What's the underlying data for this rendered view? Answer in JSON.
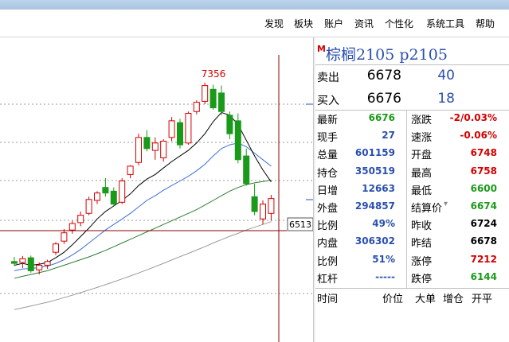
{
  "menu": [
    "发现",
    "板块",
    "账户",
    "资讯",
    "个性化",
    "系统工具",
    "帮助"
  ],
  "contract": {
    "marker": "M",
    "title": "棕榈2105  p2105"
  },
  "sell": {
    "label": "卖出",
    "price": "6678",
    "volume": "40"
  },
  "buy": {
    "label": "买入",
    "price": "6676",
    "volume": "18"
  },
  "left_stats": [
    {
      "label": "最新",
      "value": "6676",
      "color": "#1a9a1a"
    },
    {
      "label": "现手",
      "value": "27",
      "color": "#2a4fb0"
    },
    {
      "label": "总量",
      "value": "601159",
      "color": "#2a4fb0"
    },
    {
      "label": "持仓",
      "value": "350519",
      "color": "#2a4fb0"
    },
    {
      "label": "日增",
      "value": "12663",
      "color": "#2a4fb0"
    },
    {
      "label": "外盘",
      "value": "294857",
      "color": "#2a4fb0"
    },
    {
      "label": "比例",
      "value": "49%",
      "color": "#2a4fb0"
    },
    {
      "label": "内盘",
      "value": "306302",
      "color": "#2a4fb0"
    },
    {
      "label": "比例",
      "value": "51%",
      "color": "#2a4fb0"
    },
    {
      "label": "杠杆",
      "value": "-----",
      "color": "#2a4fb0"
    }
  ],
  "right_stats": [
    {
      "label": "涨跌",
      "value": "-2/0.03%",
      "color": "#d40000"
    },
    {
      "label": "速涨",
      "value": "-0.06%",
      "color": "#d40000"
    },
    {
      "label": "开盘",
      "value": "6748",
      "color": "#d40000"
    },
    {
      "label": "最高",
      "value": "6758",
      "color": "#d40000"
    },
    {
      "label": "最低",
      "value": "6600",
      "color": "#1a9a1a"
    },
    {
      "label": "结算价",
      "value": "6674",
      "color": "#1a9a1a"
    },
    {
      "label": "昨收",
      "value": "6724",
      "color": "#000000"
    },
    {
      "label": "昨结",
      "value": "6678",
      "color": "#000000"
    },
    {
      "label": "涨停",
      "value": "7212",
      "color": "#d40000"
    },
    {
      "label": "跌停",
      "value": "6144",
      "color": "#1a9a1a"
    }
  ],
  "footer": [
    "时间",
    "价位",
    "大单",
    "增仓",
    "开平"
  ],
  "chart_data": {
    "type": "candlestick",
    "high_label": "7356",
    "price_tag": "6513",
    "candles": [
      {
        "o": 6390,
        "h": 6415,
        "l": 6365,
        "c": 6380
      },
      {
        "o": 6385,
        "h": 6420,
        "l": 6355,
        "c": 6405
      },
      {
        "o": 6410,
        "h": 6422,
        "l": 6330,
        "c": 6340
      },
      {
        "o": 6345,
        "h": 6385,
        "l": 6320,
        "c": 6370
      },
      {
        "o": 6370,
        "h": 6400,
        "l": 6350,
        "c": 6390
      },
      {
        "o": 6440,
        "h": 6495,
        "l": 6425,
        "c": 6485
      },
      {
        "o": 6500,
        "h": 6565,
        "l": 6485,
        "c": 6545
      },
      {
        "o": 6560,
        "h": 6610,
        "l": 6540,
        "c": 6595
      },
      {
        "o": 6600,
        "h": 6660,
        "l": 6580,
        "c": 6640
      },
      {
        "o": 6650,
        "h": 6740,
        "l": 6640,
        "c": 6725
      },
      {
        "o": 6720,
        "h": 6770,
        "l": 6700,
        "c": 6760
      },
      {
        "o": 6790,
        "h": 6840,
        "l": 6740,
        "c": 6760
      },
      {
        "o": 6770,
        "h": 6790,
        "l": 6690,
        "c": 6700
      },
      {
        "o": 6710,
        "h": 6840,
        "l": 6700,
        "c": 6825
      },
      {
        "o": 6860,
        "h": 6910,
        "l": 6840,
        "c": 6905
      },
      {
        "o": 6925,
        "h": 7080,
        "l": 6910,
        "c": 7060
      },
      {
        "o": 7060,
        "h": 7100,
        "l": 6985,
        "c": 7000
      },
      {
        "o": 6990,
        "h": 7060,
        "l": 6940,
        "c": 7030
      },
      {
        "o": 6950,
        "h": 7050,
        "l": 6930,
        "c": 7040
      },
      {
        "o": 7060,
        "h": 7170,
        "l": 7040,
        "c": 7150
      },
      {
        "o": 7140,
        "h": 7160,
        "l": 7000,
        "c": 7020
      },
      {
        "o": 7030,
        "h": 7200,
        "l": 7020,
        "c": 7190
      },
      {
        "o": 7200,
        "h": 7260,
        "l": 7185,
        "c": 7250
      },
      {
        "o": 7255,
        "h": 7356,
        "l": 7240,
        "c": 7340
      },
      {
        "o": 7320,
        "h": 7345,
        "l": 7210,
        "c": 7220
      },
      {
        "o": 7300,
        "h": 7340,
        "l": 7180,
        "c": 7200
      },
      {
        "o": 7180,
        "h": 7200,
        "l": 7050,
        "c": 7080
      },
      {
        "o": 7150,
        "h": 7190,
        "l": 6920,
        "c": 6940
      },
      {
        "o": 6960,
        "h": 7000,
        "l": 6800,
        "c": 6810
      },
      {
        "o": 6740,
        "h": 6810,
        "l": 6640,
        "c": 6660
      },
      {
        "o": 6620,
        "h": 6720,
        "l": 6590,
        "c": 6700
      },
      {
        "o": 6650,
        "h": 6750,
        "l": 6610,
        "c": 6730
      }
    ],
    "ma_black": [
      6370,
      6380,
      6370,
      6375,
      6385,
      6410,
      6440,
      6480,
      6525,
      6570,
      6620,
      6660,
      6690,
      6720,
      6755,
      6800,
      6835,
      6860,
      6895,
      6930,
      6960,
      6990,
      7030,
      7080,
      7145,
      7195,
      7180,
      7130,
      7045,
      6960,
      6885,
      6820
    ],
    "ma_blue": [
      6340,
      6350,
      6352,
      6358,
      6365,
      6380,
      6400,
      6425,
      6455,
      6490,
      6525,
      6560,
      6590,
      6620,
      6650,
      6685,
      6720,
      6745,
      6775,
      6800,
      6825,
      6850,
      6880,
      6915,
      6960,
      7000,
      7020,
      7030,
      7010,
      6975,
      6940,
      6905
    ],
    "ma_green": [
      6300,
      6310,
      6320,
      6330,
      6340,
      6355,
      6370,
      6385,
      6400,
      6415,
      6432,
      6450,
      6470,
      6490,
      6510,
      6530,
      6550,
      6570,
      6590,
      6610,
      6630,
      6650,
      6670,
      6695,
      6720,
      6745,
      6770,
      6790,
      6805,
      6815,
      6822,
      6830
    ],
    "ma_gray": [
      6130,
      6140,
      6150,
      6160,
      6170,
      6182,
      6195,
      6208,
      6222,
      6236,
      6250,
      6265,
      6280,
      6296,
      6312,
      6328,
      6345,
      6362,
      6380,
      6398,
      6416,
      6434,
      6452,
      6470,
      6490,
      6508,
      6526,
      6542,
      6560,
      6575,
      6590,
      6605
    ]
  }
}
